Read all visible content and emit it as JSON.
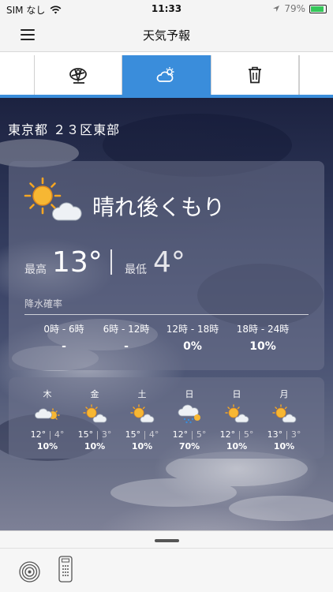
{
  "status_bar": {
    "carrier": "SIM なし",
    "time": "11:33",
    "battery": "79%",
    "battery_level": 0.79
  },
  "nav": {
    "title": "天気予報",
    "menu_icon": "hamburger-menu-icon"
  },
  "tabs": [
    {
      "name": "tab-earth",
      "icon": "earth-pin-icon",
      "selected": false
    },
    {
      "name": "tab-weather",
      "icon": "partly-cloudy-icon",
      "selected": true
    },
    {
      "name": "tab-delete",
      "icon": "trash-icon",
      "selected": false
    }
  ],
  "colors": {
    "accent": "#3a8ddb",
    "card": "#6e738c"
  },
  "forecast": {
    "location": "東京都 ２３区東部",
    "condition": "晴れ後くもり",
    "condition_icon": "sun-then-cloud-icon",
    "max_label": "最高",
    "max_temp": "13°",
    "min_label": "最低",
    "min_temp": "4°",
    "rain_title": "降水確率",
    "rain": [
      {
        "period": "0時 - 6時",
        "value": "-"
      },
      {
        "period": "6時 - 12時",
        "value": "-"
      },
      {
        "period": "12時 - 18時",
        "value": "0%"
      },
      {
        "period": "18時 - 24時",
        "value": "10%"
      }
    ]
  },
  "weekly": [
    {
      "day": "木",
      "icon": "cloud-then-sun-icon",
      "high": "12°",
      "low": "4°",
      "sep": "|",
      "pop": "10%"
    },
    {
      "day": "金",
      "icon": "sun-then-cloud-icon",
      "high": "15°",
      "low": "3°",
      "sep": "|",
      "pop": "10%"
    },
    {
      "day": "土",
      "icon": "sun-then-cloud-icon",
      "high": "15°",
      "low": "4°",
      "sep": "|",
      "pop": "10%"
    },
    {
      "day": "日",
      "icon": "cloud-rain-icon",
      "high": "12°",
      "low": "5°",
      "sep": "|",
      "pop": "70%"
    },
    {
      "day": "日",
      "icon": "sun-then-cloud-icon",
      "high": "12°",
      "low": "5°",
      "sep": "|",
      "pop": "10%"
    },
    {
      "day": "月",
      "icon": "sun-then-cloud-icon",
      "high": "13°",
      "low": "3°",
      "sep": "|",
      "pop": "10%"
    }
  ],
  "bottom_sheet": {
    "radar_icon": "radar-icon",
    "remote_icon": "remote-control-icon"
  }
}
